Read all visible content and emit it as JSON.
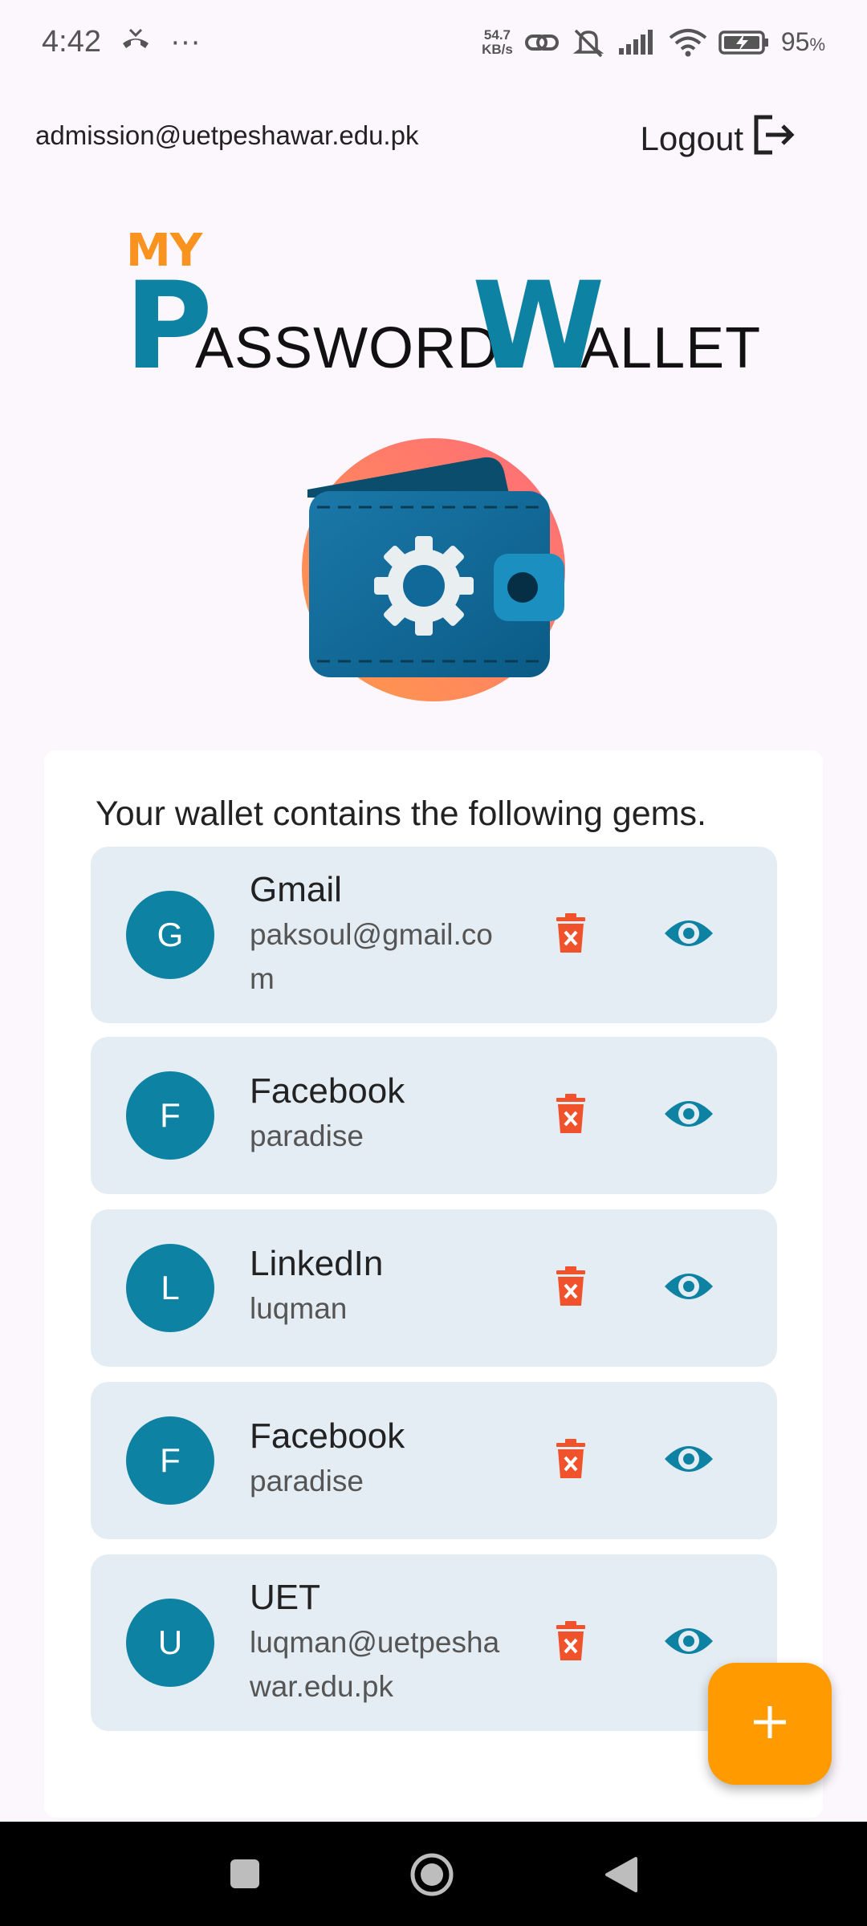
{
  "status_bar": {
    "time": "4:42",
    "dots": "···",
    "net_speed_value": "54.7",
    "net_speed_unit": "KB/s",
    "battery": "95",
    "battery_unit": "%"
  },
  "header": {
    "email": "admission@uetpeshawar.edu.pk",
    "logout_label": "Logout"
  },
  "title": {
    "my": "MY",
    "p": "P",
    "assword": "ASSWORD",
    "w": "W",
    "allet": "ALLET"
  },
  "card": {
    "heading": "Your wallet contains the following gems."
  },
  "entries": [
    {
      "initial": "G",
      "title": "Gmail",
      "subtitle": "paksoul@gmail.com"
    },
    {
      "initial": "F",
      "title": "Facebook",
      "subtitle": "paradise"
    },
    {
      "initial": "L",
      "title": "LinkedIn",
      "subtitle": "luqman"
    },
    {
      "initial": "F",
      "title": "Facebook",
      "subtitle": "paradise"
    },
    {
      "initial": "U",
      "title": "UET",
      "subtitle": "luqman@uetpeshawar.edu.pk"
    }
  ],
  "colors": {
    "accent": "#0e82a3",
    "delete": "#f0532b",
    "fab": "#ff9b00",
    "title_orange": "#f7931e"
  },
  "icons": {
    "logout": "logout-icon",
    "delete": "trash-x-icon",
    "view": "eye-icon",
    "fab": "plus-icon"
  }
}
